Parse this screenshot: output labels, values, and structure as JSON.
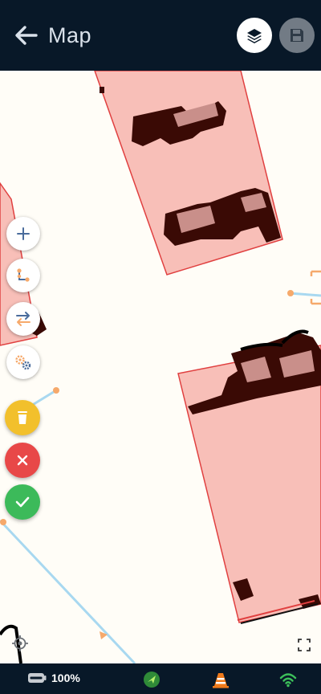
{
  "header": {
    "title": "Map",
    "back_icon": "arrow-left-icon",
    "layers_icon": "layers-icon",
    "save_icon": "floppy-disk-icon"
  },
  "toolbar": {
    "tools": [
      "zoom-in",
      "draw-line",
      "swap-direction",
      "settings"
    ],
    "actions": [
      "delete",
      "cancel",
      "confirm"
    ]
  },
  "status": {
    "battery_text": "100%",
    "icons": [
      "battery-icon",
      "gps-icon",
      "cone-icon",
      "wifi-icon"
    ]
  },
  "colors": {
    "header_bg": "#081828",
    "parcel_fill": "#f8bfb8",
    "parcel_stroke": "#e04040",
    "building": "#3a0a05",
    "line": "#a8d8f0",
    "node": "#f6a96b",
    "delete": "#f2c02c",
    "cancel": "#e84848",
    "confirm": "#3cba5a",
    "gps": "#3a9a3a",
    "cone": "#f07a1a",
    "wifi": "#3cc05a"
  }
}
